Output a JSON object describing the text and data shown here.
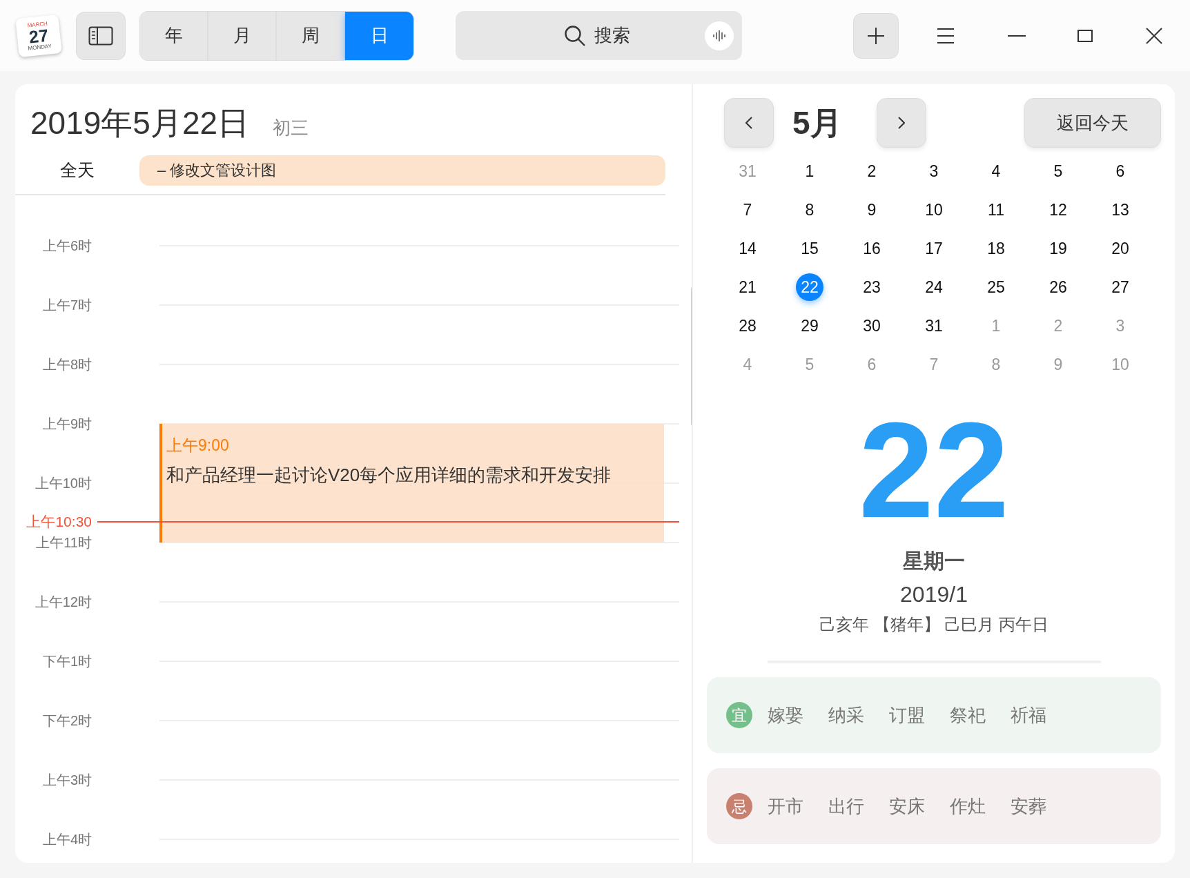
{
  "app_icon": {
    "month": "MARCH",
    "day": "27",
    "weekday": "MONDAY"
  },
  "view_tabs": [
    {
      "label": "年",
      "selected": false
    },
    {
      "label": "月",
      "selected": false
    },
    {
      "label": "周",
      "selected": false
    },
    {
      "label": "日",
      "selected": true
    }
  ],
  "search": {
    "placeholder": "搜索"
  },
  "day_view": {
    "date_title": "2019年5月22日",
    "lunar_day": "初三",
    "all_day_label": "全天",
    "all_day_events": [
      {
        "title": "– 修改文管设计图"
      }
    ],
    "hours": [
      {
        "label": "上午6时"
      },
      {
        "label": "上午7时"
      },
      {
        "label": "上午8时"
      },
      {
        "label": "上午9时",
        "events": [
          {
            "time": "上午9:00",
            "title": "和产品经理一起讨论V20每个应用详细的需求和开发安排"
          }
        ]
      },
      {
        "label": "上午10时",
        "current_time": "上午10:30"
      },
      {
        "label": "上午11时"
      },
      {
        "label": "上午12时"
      },
      {
        "label": "下午1时"
      },
      {
        "label": "下午2时"
      },
      {
        "label": "上午3时"
      },
      {
        "label": "上午4时"
      }
    ]
  },
  "mini_calendar": {
    "month": "5月",
    "today_button": "返回今天",
    "weeks": [
      [
        {
          "label": "31",
          "in_month": false,
          "selected": false
        },
        {
          "label": "1",
          "in_month": true,
          "selected": false
        },
        {
          "label": "2",
          "in_month": true,
          "selected": false
        },
        {
          "label": "3",
          "in_month": true,
          "selected": false
        },
        {
          "label": "4",
          "in_month": true,
          "selected": false
        },
        {
          "label": "5",
          "in_month": true,
          "selected": false
        },
        {
          "label": "6",
          "in_month": true,
          "selected": false
        }
      ],
      [
        {
          "label": "7",
          "in_month": true,
          "selected": false
        },
        {
          "label": "8",
          "in_month": true,
          "selected": false
        },
        {
          "label": "9",
          "in_month": true,
          "selected": false
        },
        {
          "label": "10",
          "in_month": true,
          "selected": false
        },
        {
          "label": "11",
          "in_month": true,
          "selected": false
        },
        {
          "label": "12",
          "in_month": true,
          "selected": false
        },
        {
          "label": "13",
          "in_month": true,
          "selected": false
        }
      ],
      [
        {
          "label": "14",
          "in_month": true,
          "selected": false
        },
        {
          "label": "15",
          "in_month": true,
          "selected": false
        },
        {
          "label": "16",
          "in_month": true,
          "selected": false
        },
        {
          "label": "17",
          "in_month": true,
          "selected": false
        },
        {
          "label": "18",
          "in_month": true,
          "selected": false
        },
        {
          "label": "19",
          "in_month": true,
          "selected": false
        },
        {
          "label": "20",
          "in_month": true,
          "selected": false
        }
      ],
      [
        {
          "label": "21",
          "in_month": true,
          "selected": false
        },
        {
          "label": "22",
          "in_month": true,
          "selected": true
        },
        {
          "label": "23",
          "in_month": true,
          "selected": false
        },
        {
          "label": "24",
          "in_month": true,
          "selected": false
        },
        {
          "label": "25",
          "in_month": true,
          "selected": false
        },
        {
          "label": "26",
          "in_month": true,
          "selected": false
        },
        {
          "label": "27",
          "in_month": true,
          "selected": false
        }
      ],
      [
        {
          "label": "28",
          "in_month": true,
          "selected": false
        },
        {
          "label": "29",
          "in_month": true,
          "selected": false
        },
        {
          "label": "30",
          "in_month": true,
          "selected": false
        },
        {
          "label": "31",
          "in_month": true,
          "selected": false
        },
        {
          "label": "1",
          "in_month": false,
          "selected": false
        },
        {
          "label": "2",
          "in_month": false,
          "selected": false
        },
        {
          "label": "3",
          "in_month": false,
          "selected": false
        }
      ],
      [
        {
          "label": "4",
          "in_month": false,
          "selected": false
        },
        {
          "label": "5",
          "in_month": false,
          "selected": false
        },
        {
          "label": "6",
          "in_month": false,
          "selected": false
        },
        {
          "label": "7",
          "in_month": false,
          "selected": false
        },
        {
          "label": "8",
          "in_month": false,
          "selected": false
        },
        {
          "label": "9",
          "in_month": false,
          "selected": false
        },
        {
          "label": "10",
          "in_month": false,
          "selected": false
        }
      ]
    ]
  },
  "day_detail": {
    "day": "22",
    "weekday": "星期一",
    "lunar_date": "2019/1",
    "ganzhi": "己亥年 【猪年】 己巳月 丙午日"
  },
  "almanac": [
    {
      "kind": "good",
      "badge": "宜",
      "color": "#74c08a",
      "items": [
        "嫁娶",
        "纳采",
        "订盟",
        "祭祀",
        "祈福"
      ]
    },
    {
      "kind": "bad",
      "badge": "忌",
      "color": "#c8806f",
      "items": [
        "开市",
        "出行",
        "安床",
        "作灶",
        "安葬"
      ]
    }
  ]
}
